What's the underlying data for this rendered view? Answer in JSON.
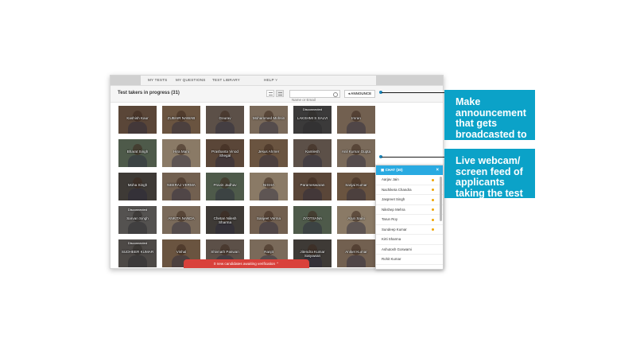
{
  "nav": {
    "items": [
      "MY TESTS",
      "MY QUESTIONS",
      "TEST LIBRARY",
      "HELP ˅"
    ]
  },
  "header": {
    "title": "Test takers in progress (31)",
    "search_placeholder": "Name or Email",
    "announce_label": "ANNOUNCE"
  },
  "tiles": [
    {
      "name": "Kashish Kaur",
      "disconnected": false
    },
    {
      "name": "ZUBAIR NAWAB",
      "disconnected": false
    },
    {
      "name": "Gourav",
      "disconnected": false
    },
    {
      "name": "Mohammed Mohsin",
      "disconnected": false
    },
    {
      "name": "LAKSHMI S SALVI",
      "disconnected": true
    },
    {
      "name": "Imran",
      "disconnected": false
    },
    {
      "name": "Bharat Singh",
      "disconnected": false
    },
    {
      "name": "Hira Mani",
      "disconnected": false
    },
    {
      "name": "Prashanta Vinod Shegal",
      "disconnected": false
    },
    {
      "name": "Jesus Ahmer",
      "disconnected": false
    },
    {
      "name": "Kamlesh",
      "disconnected": false
    },
    {
      "name": "Anil Kumar Gupta",
      "disconnected": false
    },
    {
      "name": "Moha Singh",
      "disconnected": false
    },
    {
      "name": "NEERAJ VERMA",
      "disconnected": false
    },
    {
      "name": "Pravin Jadhav",
      "disconnected": false
    },
    {
      "name": "NISHA",
      "disconnected": false
    },
    {
      "name": "Parameswaran",
      "disconnected": false
    },
    {
      "name": "Sanjai Kumar",
      "disconnected": false
    },
    {
      "name": "Sarvan Singh",
      "disconnected": true
    },
    {
      "name": "ANKITA NANDA",
      "disconnected": false
    },
    {
      "name": "Chetan Nilesh Sharma",
      "disconnected": false
    },
    {
      "name": "Sanjeet Verma",
      "disconnected": false
    },
    {
      "name": "JYOTSANA",
      "disconnected": false
    },
    {
      "name": "Arun Saini",
      "disconnected": false
    },
    {
      "name": "SUDHEER KUMAR",
      "disconnected": true
    },
    {
      "name": "Vishal",
      "disconnected": false
    },
    {
      "name": "Shivnath Paswan",
      "disconnected": false
    },
    {
      "name": "Ranjit",
      "disconnected": false
    },
    {
      "name": "Jitendra Kumar Satyawan",
      "disconnected": false
    },
    {
      "name": "Aniket Kumar",
      "disconnected": false
    }
  ],
  "disconnected_label": "Disconnected",
  "verification_bar": "0 new candidates awaiting verification ⌃",
  "chat": {
    "title": "CHAT (30)",
    "close": "×",
    "users": [
      {
        "name": "Aarjav Jain",
        "online": true
      },
      {
        "name": "Nachiketa Chandra",
        "online": true
      },
      {
        "name": "Jaspreet Singh",
        "online": true
      },
      {
        "name": "Nikshep Mehra",
        "online": true
      },
      {
        "name": "Tarun Roy",
        "online": true
      },
      {
        "name": "Sundeep Kumar",
        "online": true
      },
      {
        "name": "Kirti Sharma",
        "online": false
      },
      {
        "name": "Ashutosh Goswami",
        "online": false
      },
      {
        "name": "Rohit Kumar",
        "online": false
      }
    ]
  },
  "callouts": {
    "announce": "Make announcement that gets broadcasted to all applicants",
    "webcam": "Live webcam/ screen feed of applicants taking the test"
  },
  "colors": {
    "accent": "#0ba2c8",
    "chat_header": "#29aae1",
    "verify_bar": "#d9413b"
  }
}
